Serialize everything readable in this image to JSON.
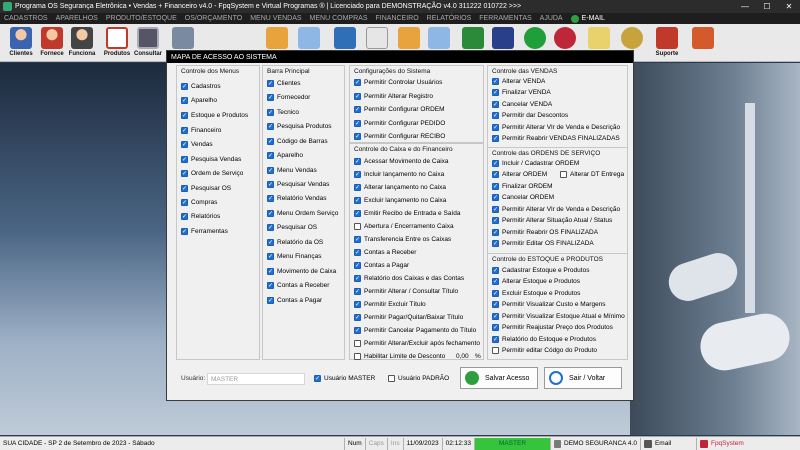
{
  "window": {
    "title": "Programa OS Segurança Eletrônica • Vendas + Financeiro v4.0 - FpqSystem e Virtual Programas ® | Licenciado para  DEMONSTRAÇÃO v4.0 311222 010722 >>>",
    "min": "—",
    "max": "☐",
    "close": "✕"
  },
  "menu": [
    "CADASTROS",
    "APARELHOS",
    "PRODUTO/ESTOQUE",
    "OS/ORÇAMENTO",
    "MENU VENDAS",
    "MENU COMPRAS",
    "FINANCEIRO",
    "RELATÓRIOS",
    "FERRAMENTAS",
    "AJUDA",
    "E-MAIL"
  ],
  "toolbar": {
    "clientes": "Clientes",
    "fornece": "Fornece",
    "funciona": "Funciona",
    "produtos": "Produtos",
    "consultar": "Consultar",
    "suporte": "Suporte"
  },
  "dialog": {
    "title": "MAPA DE ACESSO AO SISTEMA",
    "menus": {
      "title": "Controle dos Menus",
      "items": [
        "Cadastros",
        "Aparelho",
        "Estoque e Produtos",
        "Financeiro",
        "Vendas",
        "Pesquisa Vendas",
        "Ordem de Serviço",
        "Pesquisar OS",
        "Compras",
        "Relatórios",
        "Ferramentas"
      ]
    },
    "barra": {
      "title": "Barra Principal",
      "items": [
        "Clientes",
        "Fornecedor",
        "Tecnico",
        "Pesquisa Produtos",
        "Código de Barras",
        "Aparelho",
        "Menu Vendas",
        "Pesquisar Vendas",
        "Relatório Vendas",
        "Menu Ordem Serviço",
        "Pesquisar OS",
        "Relatório da OS",
        "Menu Finanças",
        "Movimento de Caixa",
        "Contas a Receber",
        "Contas a Pagar"
      ]
    },
    "config": {
      "title": "Configurações do Sistema",
      "items": [
        "Permitir Controlar Usuários",
        "Permitir Alterar Registro",
        "Permitir Configurar ORDEM",
        "Permitir Configurar PEDIDO",
        "Permitir Configurar RECIBO"
      ]
    },
    "caixa": {
      "title": "Controle do Caixa e do Financeiro",
      "items": [
        {
          "label": "Acessar Movimento de Caixa",
          "checked": true
        },
        {
          "label": "Incluir lançamento no Caixa",
          "checked": true
        },
        {
          "label": "Alterar lançamento no Caixa",
          "checked": true
        },
        {
          "label": "Excluir lançamento no Caixa",
          "checked": true
        },
        {
          "label": "Emitir Recibo de Entrada e Saída",
          "checked": true
        },
        {
          "label": "Abertura / Encerramento Caixa",
          "checked": false
        },
        {
          "label": "Transferencia Entre os Caixas",
          "checked": true
        },
        {
          "label": "Contas a Receber",
          "checked": true
        },
        {
          "label": "Contas a Pagar",
          "checked": true
        },
        {
          "label": "Relatório dos Caixas e das Contas",
          "checked": true
        },
        {
          "label": "Permitir Alterar / Consultar Título",
          "checked": true
        },
        {
          "label": "Permitir Excluir Título",
          "checked": true
        },
        {
          "label": "Permitir Pagar/Quitar/Baixar Título",
          "checked": true
        },
        {
          "label": "Permitir Cancelar Pagamento do Título",
          "checked": true
        },
        {
          "label": "Permitir Alterar/Excluir após fechamento",
          "checked": false
        },
        {
          "label": "Habilitar Limite de Desconto",
          "checked": false
        }
      ],
      "desconto_value": "0,00",
      "desconto_unit": "%"
    },
    "vendas": {
      "title": "Controle das VENDAS",
      "items": [
        "Alterar VENDA",
        "Finalizar VENDA",
        "Cancelar VENDA",
        "Permitir dar Descontos",
        "Permitir Alterar Vlr de Venda e Descrição",
        "Permitir Reabrir VENDAS FINALIZADAS"
      ]
    },
    "os": {
      "title": "Controle das ORDENS DE SERVIÇO",
      "incluir": "Incluir / Cadastrar ORDEM",
      "alterar": "Alterar ORDEM",
      "alterar_dt": "Alterar DT Entrega",
      "items": [
        "Finalizar ORDEM",
        "Cancelar ORDEM",
        "Permitir Alterar Vlr de Venda e Descrição",
        "Permitir Alterar Situação Atual / Status",
        "Permitir Reabrir OS FINALIZADA",
        "Permitir Editar OS FINALIZADA"
      ]
    },
    "estoque": {
      "title": "Controle do ESTOQUE e PRODUTOS",
      "items": [
        {
          "label": "Cadastrar Estoque e Produtos",
          "checked": true
        },
        {
          "label": "Alterar Estoque e Produtos",
          "checked": true
        },
        {
          "label": "Excluir Estoque e Produtos",
          "checked": true
        },
        {
          "label": "Permitir Visualizar Custo e Margens",
          "checked": true
        },
        {
          "label": "Permitir Visualizar Estoque Atual e Mínimo",
          "checked": true
        },
        {
          "label": "Permitir Reajustar Preço dos Produtos",
          "checked": true
        },
        {
          "label": "Relatório do Estoque e Produtos",
          "checked": true
        },
        {
          "label": "Permitir editar Códgo do Produto",
          "checked": false
        }
      ]
    },
    "footer": {
      "usuario_label": "Usuário:",
      "usuario_value": "MASTER",
      "usuario_master": "Usuário MASTER",
      "usuario_padrao": "Usuário PADRÃO",
      "salvar": "Salvar Acesso",
      "sair": "Sair / Voltar"
    }
  },
  "status": {
    "location": "SUA CIDADE - SP  2 de Setembro de 2023 - Sábado",
    "num": "Num",
    "caps": "Caps",
    "ins": "Ins",
    "date": "11/09/2023",
    "time": "02:12:33",
    "user": "MASTER",
    "company": "DEMO SEGURANCA 4.0",
    "email": "Email",
    "brand": "FpqSystem"
  }
}
